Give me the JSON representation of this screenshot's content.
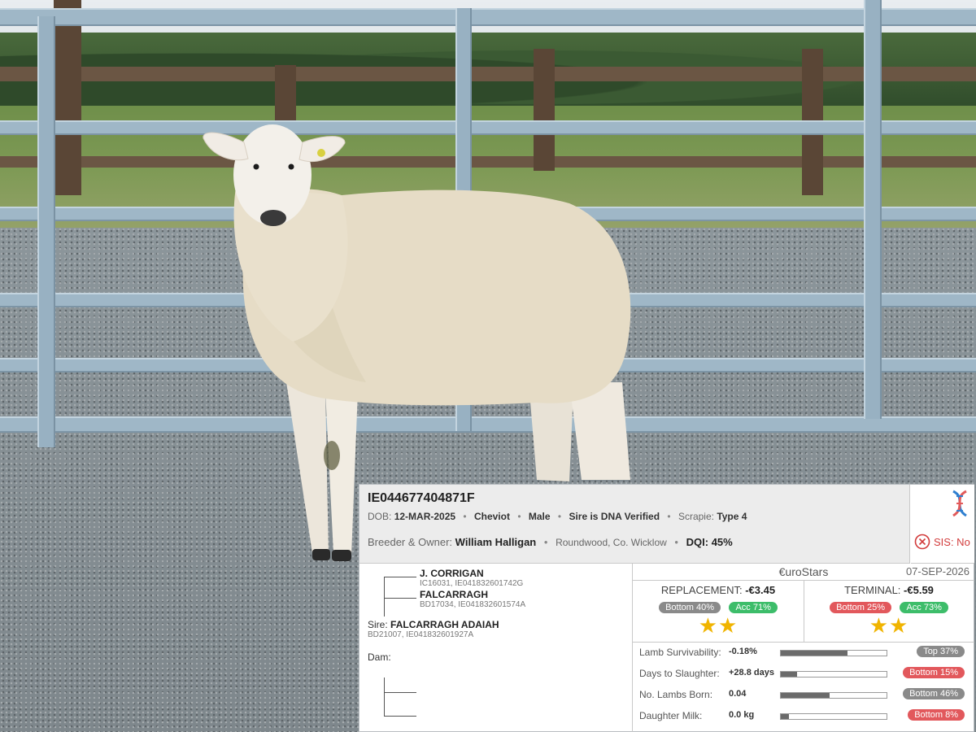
{
  "animal": {
    "tag": "IE044677404871F",
    "dob_label": "DOB:",
    "dob": "12-MAR-2025",
    "breed": "Cheviot",
    "sex": "Male",
    "sire_dna": "Sire is DNA Verified",
    "scrapie_label": "Scrapie:",
    "scrapie": "Type 4",
    "breeder_label": "Breeder & Owner:",
    "breeder": "William Halligan",
    "location": "Roundwood, Co. Wicklow",
    "dqi_label": "DQI:",
    "dqi": "45%",
    "sis": "SIS: No",
    "icons": {
      "dna": "dna-icon",
      "sis": "circle-x-icon"
    }
  },
  "pedigree": {
    "grandsire": {
      "name": "J. CORRIGAN",
      "ids": "IC16031, IE041832601742G"
    },
    "granddam": {
      "name": "FALCARRAGH",
      "ids": "BD17034, IE041832601574A"
    },
    "sire_label": "Sire:",
    "sire": {
      "name": "FALCARRAGH ADAIAH",
      "ids": "BD21007, IE041832601927A"
    },
    "dam_label": "Dam:"
  },
  "eurostars": {
    "title": "€uroStars",
    "date": "07-SEP-2026",
    "replacement": {
      "label": "REPLACEMENT:",
      "value": "-€3.45",
      "rank": "Bottom 40%",
      "acc": "Acc 71%",
      "stars": "★★",
      "star_count": 2
    },
    "terminal": {
      "label": "TERMINAL:",
      "value": "-€5.59",
      "rank": "Bottom 25%",
      "acc": "Acc 73%",
      "stars": "★★",
      "star_count": 2
    }
  },
  "traits": [
    {
      "name": "Lamb Survivability:",
      "value": "-0.18%",
      "fill": 0.63,
      "rank": "Top 37%",
      "rank_color": "grey"
    },
    {
      "name": "Days to Slaughter:",
      "value": "+28.8 days",
      "fill": 0.15,
      "rank": "Bottom 15%",
      "rank_color": "red"
    },
    {
      "name": "No. Lambs Born:",
      "value": "0.04",
      "fill": 0.46,
      "rank": "Bottom 46%",
      "rank_color": "grey"
    },
    {
      "name": "Daughter Milk:",
      "value": "0.0 kg",
      "fill": 0.08,
      "rank": "Bottom 8%",
      "rank_color": "red"
    }
  ],
  "colors": {
    "star": "#f0b400",
    "red": "#e2585c",
    "green": "#3dbd6a",
    "grey": "#8a8a8a",
    "sis": "#d23b3b"
  }
}
